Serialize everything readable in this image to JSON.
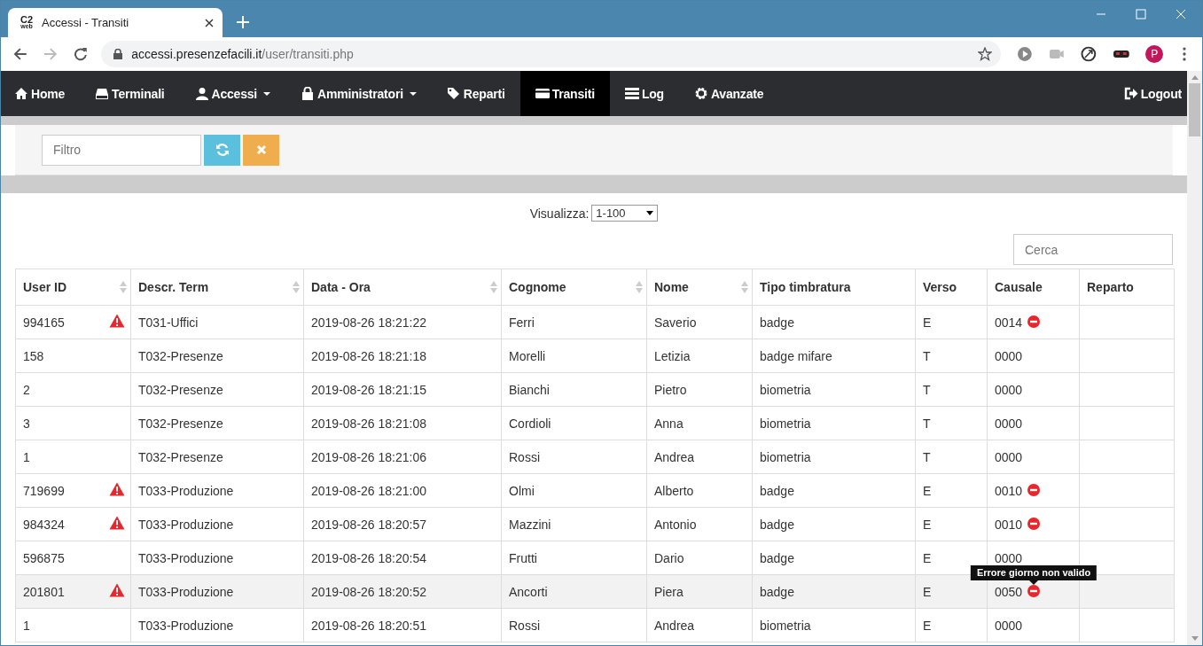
{
  "browser": {
    "tab_title": "Accessi - Transiti",
    "favicon": "C2",
    "favicon_sub": "web",
    "url_host": "accessi.presenzefacili.it",
    "url_path": "/user/transiti.php",
    "profile_initial": "P"
  },
  "nav": {
    "items": [
      {
        "label": "Home",
        "dropdown": false,
        "selected": false
      },
      {
        "label": "Terminali",
        "dropdown": false,
        "selected": false
      },
      {
        "label": "Accessi",
        "dropdown": true,
        "selected": false
      },
      {
        "label": "Amministratori",
        "dropdown": true,
        "selected": false
      },
      {
        "label": "Reparti",
        "dropdown": false,
        "selected": false
      },
      {
        "label": "Transiti",
        "dropdown": false,
        "selected": true
      },
      {
        "label": "Log",
        "dropdown": false,
        "selected": false
      },
      {
        "label": "Avanzate",
        "dropdown": false,
        "selected": false
      }
    ],
    "logout": "Logout"
  },
  "filter": {
    "placeholder": "Filtro"
  },
  "pager": {
    "label": "Visualizza:",
    "value": "1-100"
  },
  "search": {
    "placeholder": "Cerca"
  },
  "table": {
    "columns": [
      {
        "label": "User ID",
        "sortable": true
      },
      {
        "label": "Descr. Term",
        "sortable": true
      },
      {
        "label": "Data - Ora",
        "sortable": true
      },
      {
        "label": "Cognome",
        "sortable": true
      },
      {
        "label": "Nome",
        "sortable": true
      },
      {
        "label": "Tipo timbratura",
        "sortable": false
      },
      {
        "label": "Verso",
        "sortable": false
      },
      {
        "label": "Causale",
        "sortable": false
      },
      {
        "label": "Reparto",
        "sortable": false
      }
    ],
    "rows": [
      {
        "cells": [
          "994165",
          "T031-Uffici",
          "2019-08-26 18:21:22",
          "Ferri",
          "Saverio",
          "badge",
          "E",
          "0014",
          ""
        ],
        "warning": true,
        "error": true,
        "highlighted": false
      },
      {
        "cells": [
          "158",
          "T032-Presenze",
          "2019-08-26 18:21:18",
          "Morelli",
          "Letizia",
          "badge mifare",
          "T",
          "0000",
          ""
        ],
        "warning": false,
        "error": false,
        "highlighted": false
      },
      {
        "cells": [
          "2",
          "T032-Presenze",
          "2019-08-26 18:21:15",
          "Bianchi",
          "Pietro",
          "biometria",
          "T",
          "0000",
          ""
        ],
        "warning": false,
        "error": false,
        "highlighted": false
      },
      {
        "cells": [
          "3",
          "T032-Presenze",
          "2019-08-26 18:21:08",
          "Cordioli",
          "Anna",
          "biometria",
          "T",
          "0000",
          ""
        ],
        "warning": false,
        "error": false,
        "highlighted": false
      },
      {
        "cells": [
          "1",
          "T032-Presenze",
          "2019-08-26 18:21:06",
          "Rossi",
          "Andrea",
          "biometria",
          "T",
          "0000",
          ""
        ],
        "warning": false,
        "error": false,
        "highlighted": false
      },
      {
        "cells": [
          "719699",
          "T033-Produzione",
          "2019-08-26 18:21:00",
          "Olmi",
          "Alberto",
          "badge",
          "E",
          "0010",
          ""
        ],
        "warning": true,
        "error": true,
        "highlighted": false
      },
      {
        "cells": [
          "984324",
          "T033-Produzione",
          "2019-08-26 18:20:57",
          "Mazzini",
          "Antonio",
          "badge",
          "E",
          "0010",
          ""
        ],
        "warning": true,
        "error": true,
        "highlighted": false
      },
      {
        "cells": [
          "596875",
          "T033-Produzione",
          "2019-08-26 18:20:54",
          "Frutti",
          "Dario",
          "badge",
          "E",
          "0000",
          ""
        ],
        "warning": false,
        "error": false,
        "highlighted": false
      },
      {
        "cells": [
          "201801",
          "T033-Produzione",
          "2019-08-26 18:20:52",
          "Ancorti",
          "Piera",
          "badge",
          "E",
          "0050",
          ""
        ],
        "warning": true,
        "error": true,
        "highlighted": true,
        "tooltip": "Errore giorno non valido"
      },
      {
        "cells": [
          "1",
          "T033-Produzione",
          "2019-08-26 18:20:51",
          "Rossi",
          "Andrea",
          "biometria",
          "E",
          "0000",
          ""
        ],
        "warning": false,
        "error": false,
        "highlighted": false
      }
    ]
  }
}
